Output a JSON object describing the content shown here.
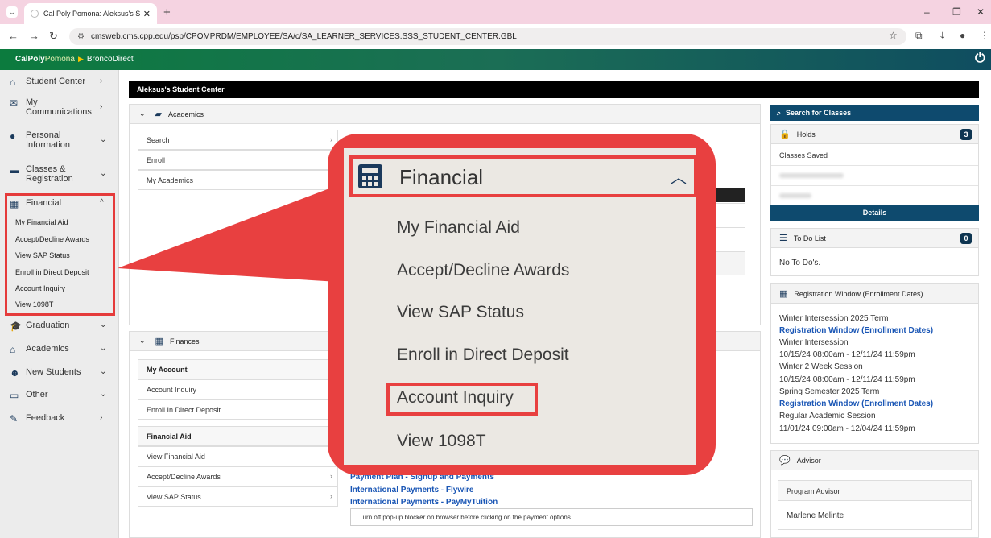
{
  "browser": {
    "tab_title": "Cal Poly Pomona: Aleksus's Stu",
    "url": "cmsweb.cms.cpp.edu/psp/CPOMPRDM/EMPLOYEE/SA/c/SA_LEARNER_SERVICES.SSS_STUDENT_CENTER.GBL"
  },
  "header": {
    "brand_bold": "CalPoly",
    "brand_light": "Pomona",
    "app_name": "BroncoDirect"
  },
  "sidebar": {
    "items": [
      {
        "label": "Student Center",
        "icon": "home-icon"
      },
      {
        "label": "My Communications",
        "icon": "envelope-icon"
      },
      {
        "label": "Personal Information",
        "icon": "person-icon"
      },
      {
        "label": "Classes & Registration",
        "icon": "book-icon"
      },
      {
        "label": "Financial",
        "icon": "calculator-icon"
      },
      {
        "label": "Graduation",
        "icon": "graduation-cap-icon"
      },
      {
        "label": "Academics",
        "icon": "institution-icon"
      },
      {
        "label": "New Students",
        "icon": "users-icon"
      },
      {
        "label": "Other",
        "icon": "monitor-icon"
      },
      {
        "label": "Feedback",
        "icon": "pencil-icon"
      }
    ],
    "financial_sub": [
      "My Financial Aid",
      "Accept/Decline Awards",
      "View SAP Status",
      "Enroll in Direct Deposit",
      "Account Inquiry",
      "View 1098T"
    ]
  },
  "main": {
    "page_title": "Aleksus's Student Center",
    "academics": {
      "title": "Academics",
      "links": [
        "Search",
        "Enroll",
        "My Academics"
      ]
    },
    "finances": {
      "title": "Finances",
      "my_account_header": "My Account",
      "my_account_links": [
        "Account Inquiry",
        "Enroll In Direct Deposit"
      ],
      "financial_aid_header": "Financial Aid",
      "financial_aid_links": [
        "View Financial Aid",
        "Accept/Decline Awards",
        "View SAP Status"
      ],
      "payment_links": [
        "Payment Plan - Signup and Payments",
        "International Payments - Flywire",
        "International Payments - PayMyTuition"
      ],
      "note": "Turn off pop-up blocker on browser before clicking on the payment options"
    }
  },
  "right": {
    "search_button": "Search for Classes",
    "holds": {
      "title": "Holds",
      "count": "3",
      "item": "Classes Saved",
      "details_button": "Details"
    },
    "todo": {
      "title": "To Do List",
      "count": "0",
      "text": "No To Do's."
    },
    "registration": {
      "title": "Registration Window (Enrollment Dates)",
      "lines": [
        {
          "text": "Winter Intersession 2025 Term",
          "link": false
        },
        {
          "text": "Registration Window (Enrollment Dates)",
          "link": true
        },
        {
          "text": "Winter Intersession",
          "link": false
        },
        {
          "text": "10/15/24 08:00am - 12/11/24 11:59pm",
          "link": false
        },
        {
          "text": "Winter 2 Week Session",
          "link": false
        },
        {
          "text": "10/15/24 08:00am - 12/11/24 11:59pm",
          "link": false
        },
        {
          "text": "Spring Semester 2025 Term",
          "link": false
        },
        {
          "text": "Registration Window (Enrollment Dates)",
          "link": true
        },
        {
          "text": "Regular Academic Session",
          "link": false
        },
        {
          "text": "11/01/24 09:00am - 12/04/24 11:59pm",
          "link": false
        }
      ]
    },
    "advisor": {
      "title": "Advisor",
      "label": "Program Advisor",
      "name": "Marlene Melinte"
    }
  },
  "callout": {
    "title": "Financial",
    "items": [
      "My Financial Aid",
      "Accept/Decline Awards",
      "View SAP Status",
      "Enroll in Direct Deposit",
      "Account Inquiry",
      "View 1098T"
    ]
  },
  "colors": {
    "highlight": "#e84040",
    "brand_green": "#0c7b3e",
    "link_blue": "#1a56b5",
    "navy": "#0e4a6e"
  }
}
